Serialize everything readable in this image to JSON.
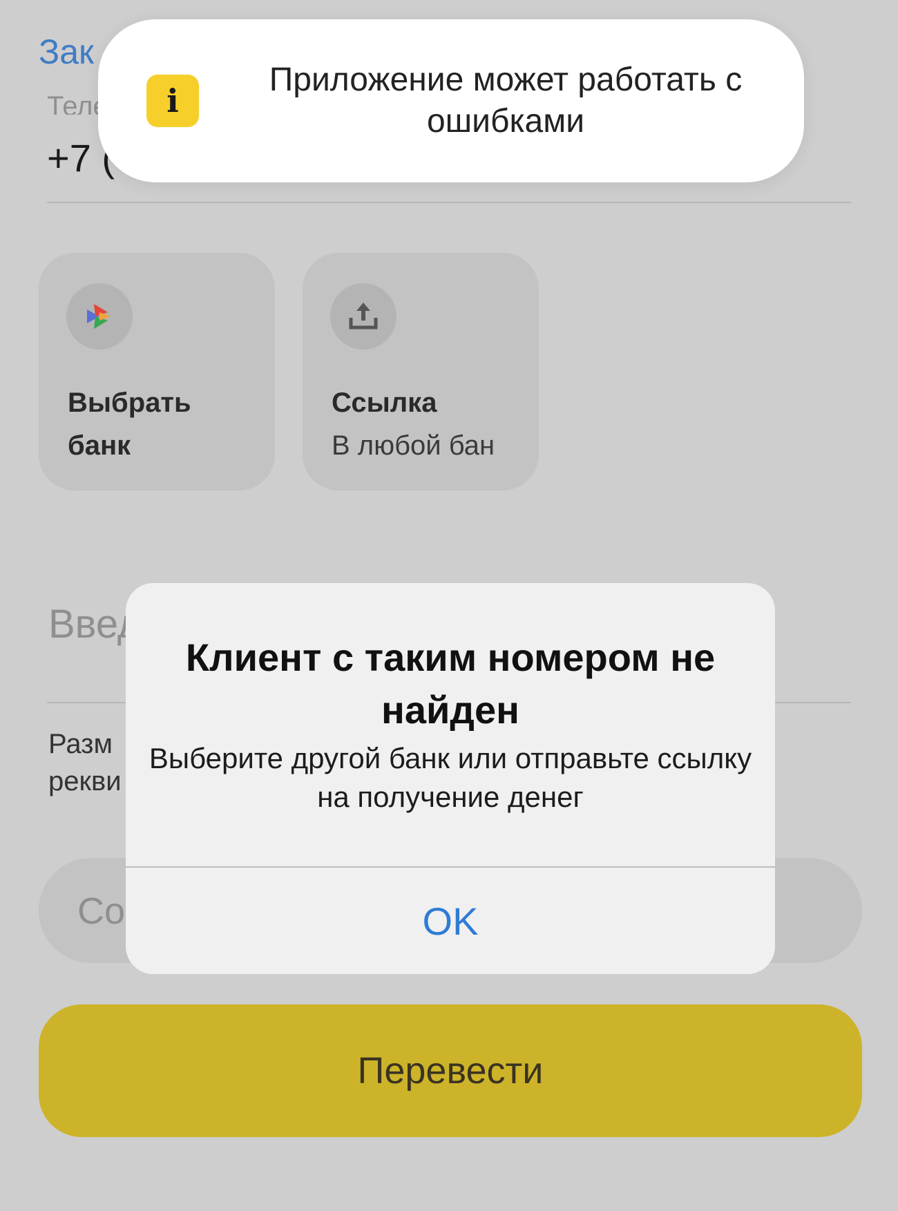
{
  "header": {
    "back_link": "Зак"
  },
  "phone_field": {
    "caption": "Телефон",
    "value": "+7 ("
  },
  "tiles": [
    {
      "title": "Выбрать банк",
      "subtitle": "",
      "icon": "bank-select-icon"
    },
    {
      "title": "Ссылка",
      "subtitle": "В любой бан",
      "icon": "share-upload-icon"
    }
  ],
  "amount_field": {
    "placeholder": "Введ"
  },
  "note": {
    "text": "Разм\nрекви"
  },
  "comment_field": {
    "placeholder": "Со"
  },
  "transfer_button": {
    "label": "Перевести"
  },
  "toast": {
    "icon": "info-icon",
    "icon_glyph": "i",
    "text": "Приложение может работать с ошибками",
    "icon_color": "#f6cf2a"
  },
  "alert": {
    "title": "Клиент с таким номером не найден",
    "message": "Выберите другой банк или отправьте ссылку на получение денег",
    "ok_label": "OK"
  },
  "colors": {
    "accent_yellow": "#cdb329",
    "link_blue": "#2f7bd5",
    "overlay_background": "#cecece"
  }
}
